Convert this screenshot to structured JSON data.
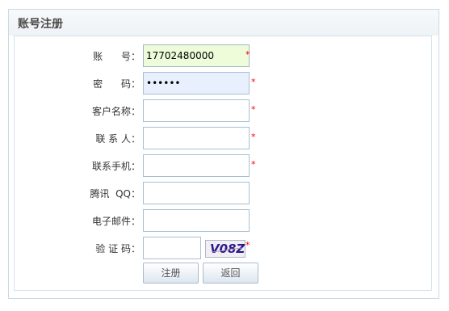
{
  "panel": {
    "title": "账号注册"
  },
  "form": {
    "account": {
      "label": "账      号：",
      "value": "17702480000",
      "required": "*"
    },
    "password": {
      "label": "密      码：",
      "value": "••••••",
      "required": "*"
    },
    "customer_name": {
      "label": "客户名称：",
      "value": "",
      "required": "*"
    },
    "contact": {
      "label": "联 系 人：",
      "value": "",
      "required": "*"
    },
    "mobile": {
      "label": "联系手机：",
      "value": "",
      "required": "*"
    },
    "qq": {
      "label": "腾讯  QQ：",
      "value": ""
    },
    "email": {
      "label": "电子邮件：",
      "value": ""
    },
    "captcha": {
      "label": "验 证 码：",
      "value": "",
      "image_text": "V08Z",
      "required": "*"
    }
  },
  "buttons": {
    "submit": "注册",
    "back": "返回"
  },
  "colors": {
    "required": "#ff0000",
    "focus_bg": "#eefcd9",
    "autofill_bg": "#e8f0fe"
  }
}
